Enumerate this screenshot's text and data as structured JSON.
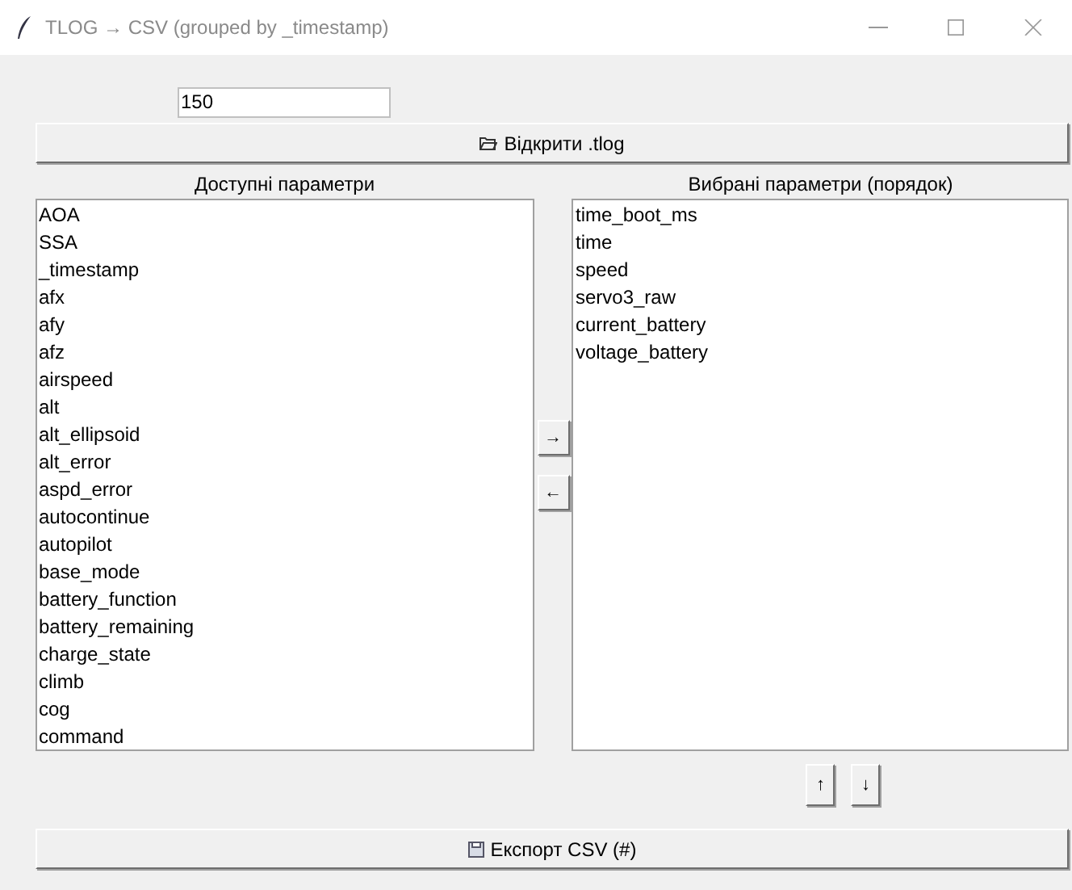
{
  "window": {
    "title": "TLOG → CSV (grouped by _timestamp)"
  },
  "interval_field": {
    "value": "150"
  },
  "open_button": {
    "label": "Відкрити .tlog"
  },
  "available": {
    "heading": "Доступні параметри",
    "items": [
      "AOA",
      "SSA",
      "_timestamp",
      "afx",
      "afy",
      "afz",
      "airspeed",
      "alt",
      "alt_ellipsoid",
      "alt_error",
      "aspd_error",
      "autocontinue",
      "autopilot",
      "base_mode",
      "battery_function",
      "battery_remaining",
      "charge_state",
      "climb",
      "cog",
      "command"
    ]
  },
  "selected": {
    "heading": "Вибрані параметри (порядок)",
    "items": [
      "time_boot_ms",
      "time",
      "speed",
      "servo3_raw",
      "current_battery",
      "voltage_battery"
    ]
  },
  "transfer_buttons": [
    "→",
    "←"
  ],
  "order_buttons": [
    "↑",
    "↓"
  ],
  "export_button": {
    "label": "Експорт CSV (#)"
  }
}
